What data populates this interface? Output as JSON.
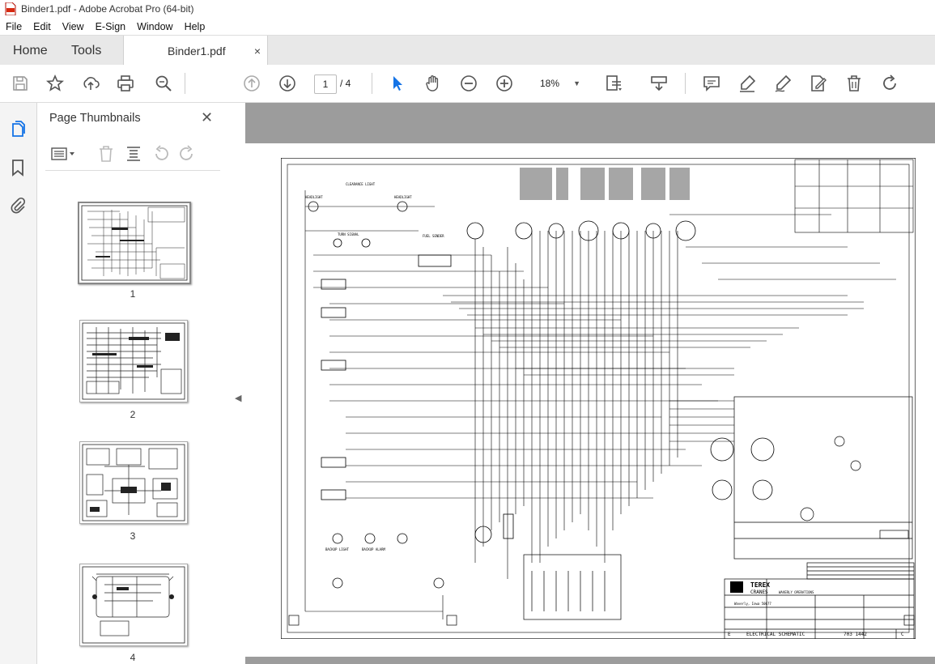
{
  "window": {
    "title": "Binder1.pdf - Adobe Acrobat Pro (64-bit)"
  },
  "menu": [
    "File",
    "Edit",
    "View",
    "E-Sign",
    "Window",
    "Help"
  ],
  "tabs": {
    "home": "Home",
    "tools": "Tools",
    "document": "Binder1.pdf",
    "close": "×"
  },
  "toolbar": {
    "page_current": "1",
    "page_total": "/ 4",
    "zoom": "18%"
  },
  "panel": {
    "title": "Page Thumbnails",
    "close": "✕",
    "pages": [
      "1",
      "2",
      "3",
      "4"
    ]
  },
  "drawing": {
    "company": "TEREX",
    "division": "CRANES",
    "location": "WAVERLY OPERATIONS",
    "city": "Waverly, Iowa 50677",
    "sheet_title": "ELECTRICAL SCHEMATIC",
    "drawing_number": "703 1442",
    "revision": "C",
    "size": "E",
    "labels": {
      "clearance_light": "CLEARANCE LIGHT",
      "headlight": "HEADLIGHT",
      "turn_signal": "TURN SIGNAL",
      "fuel_sender": "FUEL SENDER",
      "backup_alarm": "BACKUP ALARM",
      "backup_light": "BACKUP LIGHT"
    }
  },
  "icons": [
    "acrobat-pdf-icon",
    "save-icon",
    "bookmark-star-icon",
    "upload-icon",
    "print-icon",
    "search-zoom-icon",
    "page-up-icon",
    "page-down-icon",
    "select-arrow-icon",
    "hand-icon",
    "zoom-out-icon",
    "zoom-in-icon",
    "fit-page-icon",
    "scroll-mode-icon",
    "comment-icon",
    "highlight-icon",
    "sign-icon",
    "edit-pdf-icon",
    "delete-icon",
    "rotate-icon"
  ],
  "colors": {
    "accent": "#1473e6",
    "tabbar": "#e8e8e8",
    "doc_background": "#9c9c9c"
  }
}
